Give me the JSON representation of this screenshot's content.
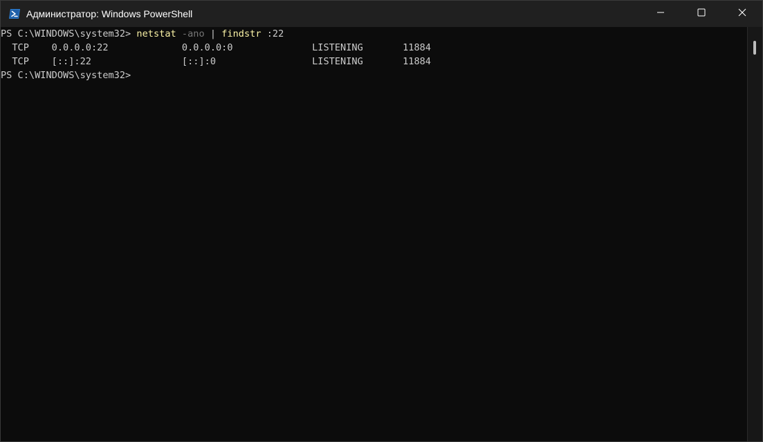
{
  "window": {
    "title": "Администратор: Windows PowerShell",
    "minimize_label": "Minimize",
    "maximize_label": "Maximize",
    "close_label": "Close"
  },
  "console": {
    "prompt": "PS C:\\WINDOWS\\system32> ",
    "command": {
      "cmd": "netstat",
      "param": "-ano",
      "pipe": "|",
      "cmd2": "findstr",
      "arg": ":22"
    },
    "output": [
      "  TCP    0.0.0.0:22             0.0.0.0:0              LISTENING       11884",
      "  TCP    [::]:22                [::]:0                 LISTENING       11884"
    ],
    "final_prompt": "PS C:\\WINDOWS\\system32>"
  },
  "colors": {
    "background": "#0c0c0c",
    "titlebar": "#202020",
    "text": "#cccccc",
    "command": "#f9f1a5",
    "parameter": "#767676"
  },
  "icons": {
    "app": "powershell-icon",
    "minimize": "minimize-icon",
    "maximize": "maximize-icon",
    "close": "close-icon"
  }
}
